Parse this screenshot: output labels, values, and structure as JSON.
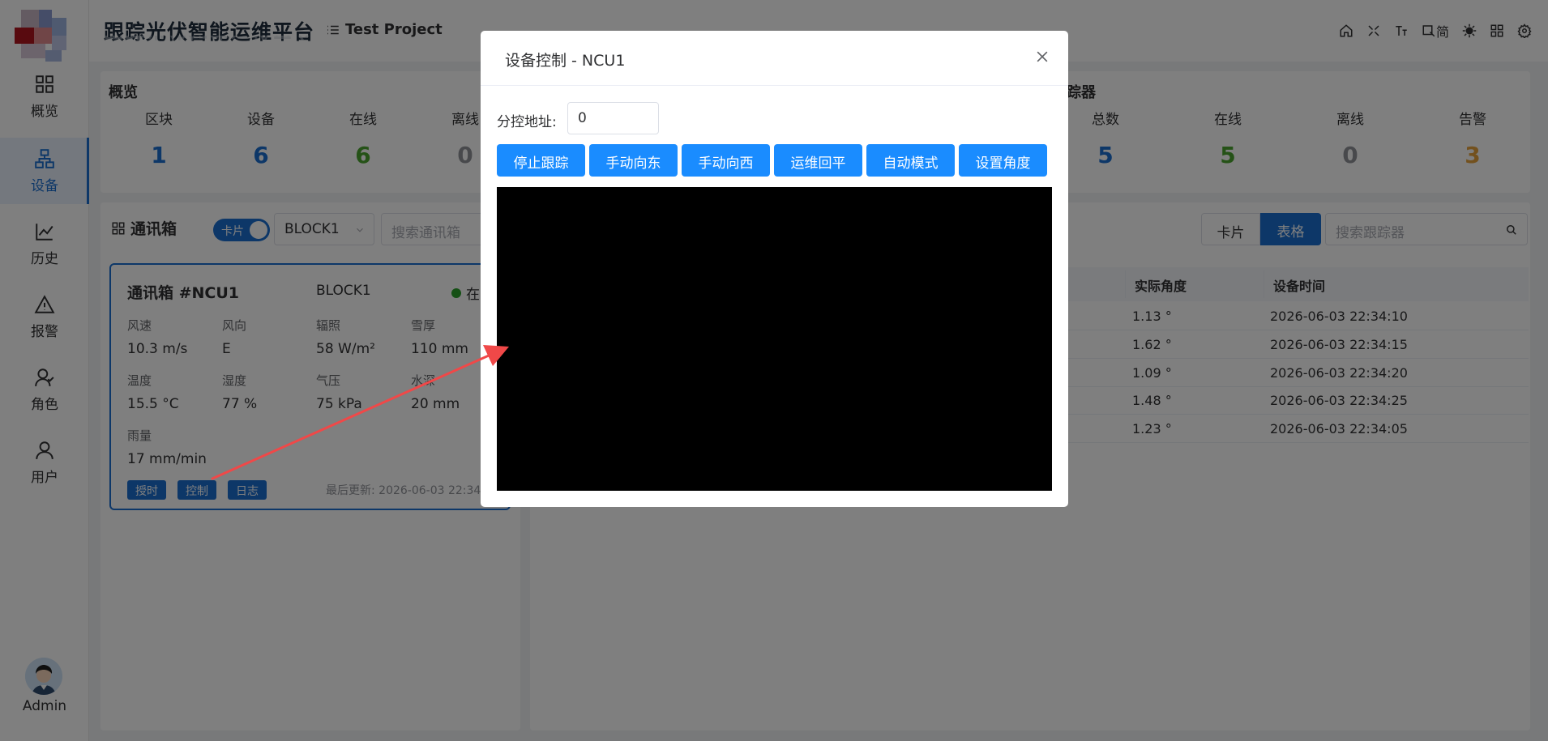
{
  "app": {
    "title": "跟踪光伏智能运维平台",
    "project": "Test Project"
  },
  "header_icons": [
    "home-icon",
    "fullscreen-icon",
    "font-size-icon",
    "language-icon",
    "theme-icon",
    "layout-icon",
    "settings-icon"
  ],
  "header": {
    "lang_label": "简"
  },
  "sidebar": {
    "items": [
      {
        "label": "概览",
        "icon": "grid-icon"
      },
      {
        "label": "设备",
        "icon": "device-icon",
        "active": true
      },
      {
        "label": "历史",
        "icon": "chart-line-icon"
      },
      {
        "label": "报警",
        "icon": "warning-icon"
      },
      {
        "label": "角色",
        "icon": "role-icon"
      },
      {
        "label": "用户",
        "icon": "user-icon"
      }
    ],
    "user": "Admin"
  },
  "overview": {
    "title": "概览",
    "stats": [
      {
        "label": "区块",
        "value": "1",
        "color": "#1a6fd1"
      },
      {
        "label": "设备",
        "value": "6",
        "color": "#1a6fd1"
      },
      {
        "label": "在线",
        "value": "6",
        "color": "#4aa52e"
      },
      {
        "label": "离线",
        "value": "0",
        "color": "#909399"
      }
    ]
  },
  "tracker_overview": {
    "title": "踪器",
    "stats": [
      {
        "label": "总数",
        "value": "5",
        "color": "#1a6fd1"
      },
      {
        "label": "在线",
        "value": "5",
        "color": "#4aa52e"
      },
      {
        "label": "离线",
        "value": "0",
        "color": "#909399"
      },
      {
        "label": "告警",
        "value": "3",
        "color": "#e6a23c"
      }
    ]
  },
  "left_panel": {
    "title": "通讯箱",
    "toggle_label": "卡片",
    "block_select": "BLOCK1",
    "search_placeholder": "搜索通讯箱"
  },
  "ncu_card": {
    "title": "通讯箱 #NCU1",
    "block": "BLOCK1",
    "status": "在",
    "metrics": [
      {
        "label": "风速",
        "value": "10.3 m/s"
      },
      {
        "label": "风向",
        "value": "E"
      },
      {
        "label": "辐照",
        "value": "58 W/m²"
      },
      {
        "label": "雪厚",
        "value": "110 mm"
      },
      {
        "label": "温度",
        "value": "15.5 °C"
      },
      {
        "label": "湿度",
        "value": "77 %"
      },
      {
        "label": "气压",
        "value": "75 kPa"
      },
      {
        "label": "水深",
        "value": "20 mm"
      },
      {
        "label": "雨量",
        "value": "17 mm/min"
      }
    ],
    "buttons": [
      "授时",
      "控制",
      "日志"
    ],
    "last_update": "最后更新: 2026-06-03 22:34:"
  },
  "right_panel": {
    "seg_card": "卡片",
    "seg_table": "表格",
    "search_placeholder": "搜索跟踪器",
    "columns": [
      "实际角度",
      "设备时间"
    ],
    "rows": [
      {
        "angle": "1.13 °",
        "time": "2026-06-03 22:34:10"
      },
      {
        "angle": "1.62 °",
        "time": "2026-06-03 22:34:15"
      },
      {
        "angle": "1.09 °",
        "time": "2026-06-03 22:34:20"
      },
      {
        "angle": "1.48 °",
        "time": "2026-06-03 22:34:25"
      },
      {
        "angle": "1.23 °",
        "time": "2026-06-03 22:34:05"
      }
    ]
  },
  "modal": {
    "title": "设备控制 - NCU1",
    "address_label": "分控地址:",
    "address_value": "0",
    "buttons": [
      "停止跟踪",
      "手动向东",
      "手动向西",
      "运维回平",
      "自动模式",
      "设置角度"
    ]
  },
  "colors": {
    "primary": "#1a6fd1",
    "button": "#1a8cff",
    "annotation_arrow": "#f04848"
  }
}
